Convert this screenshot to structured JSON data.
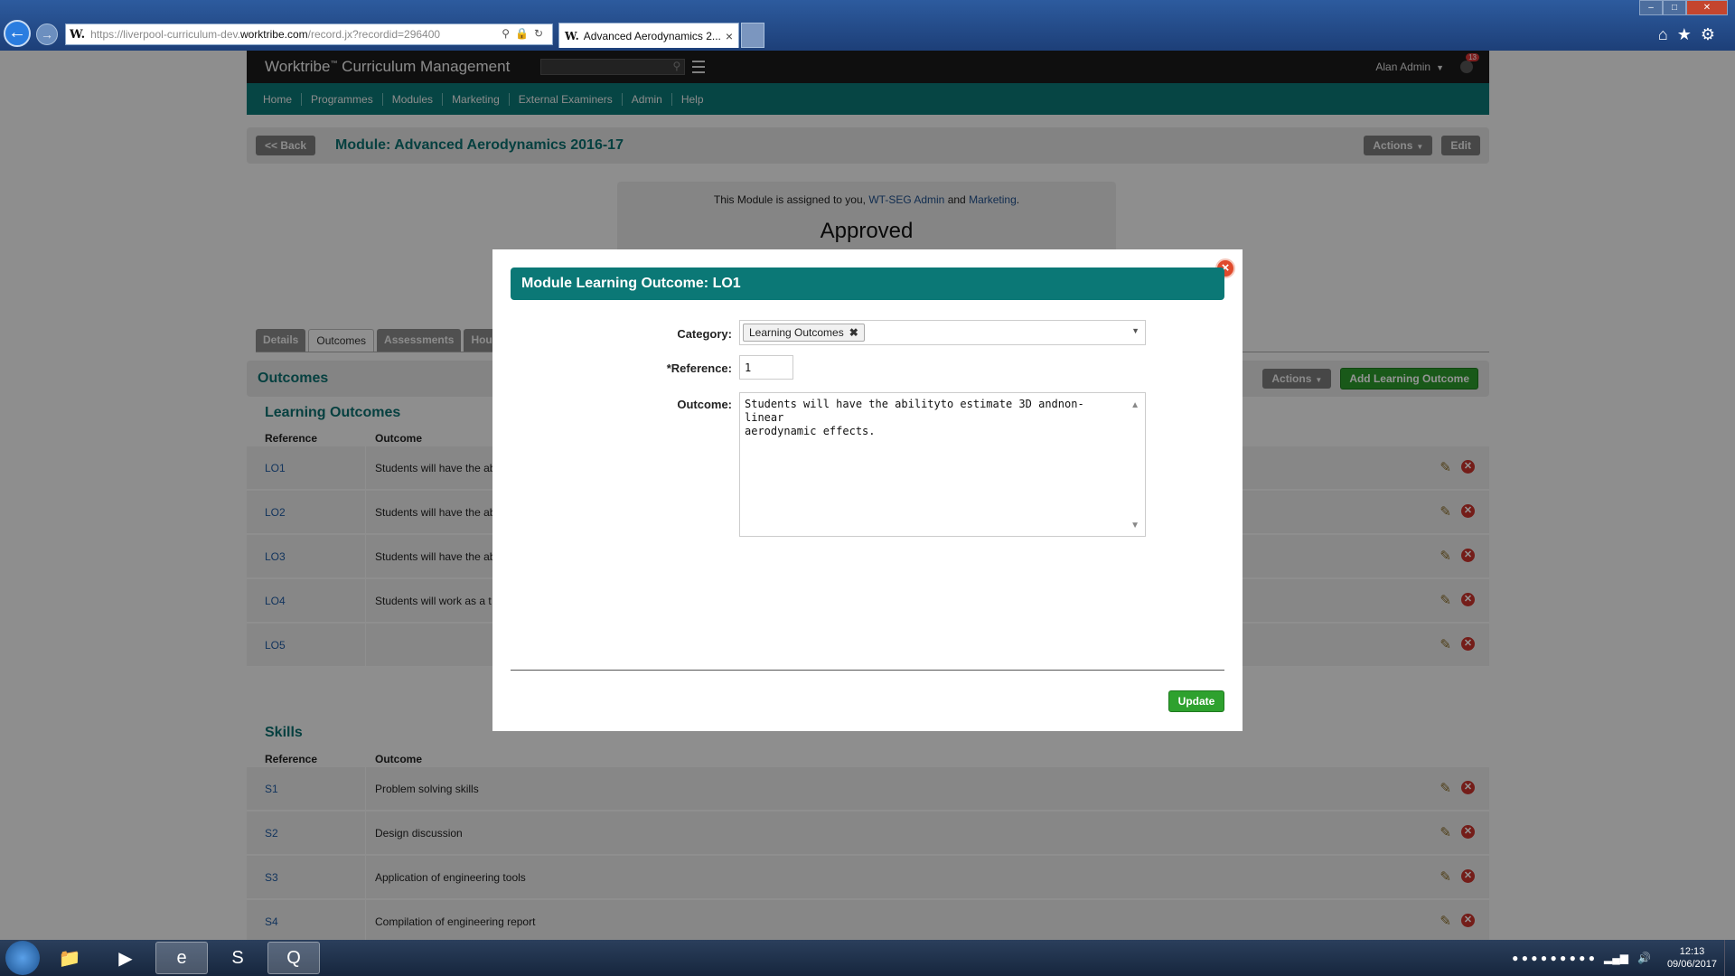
{
  "browser": {
    "favicon_letter": "W.",
    "url_prefix": "https://liverpool-curriculum-dev.",
    "url_domain": "worktribe.com",
    "url_path": "/record.jx?recordid=296400",
    "tab_title": "Advanced Aerodynamics 2...",
    "tab_close": "×"
  },
  "app": {
    "title": "Worktribe",
    "title_mark": "™",
    "title_rest": " Curriculum Management",
    "user": "Alan Admin",
    "notifications": "13"
  },
  "nav": [
    "Home",
    "Programmes",
    "Modules",
    "Marketing",
    "External Examiners",
    "Admin",
    "Help"
  ],
  "record": {
    "back_label": "<< Back",
    "title": "Module: Advanced Aerodynamics 2016-17",
    "actions_label": "Actions",
    "edit_label": "Edit"
  },
  "assignment": {
    "prefix": "This Module is assigned to you,",
    "link1": "WT-SEG Admin",
    "mid": "and",
    "link2": "Marketing",
    "suffix": ".",
    "status": "Approved"
  },
  "tabs": [
    "Details",
    "Outcomes",
    "Assessments",
    "Hour"
  ],
  "outcomes": {
    "title": "Outcomes",
    "actions_label": "Actions",
    "add_label": "Add Learning Outcome",
    "learning_title": "Learning Outcomes",
    "col_reference": "Reference",
    "col_outcome": "Outcome",
    "learning_rows": [
      {
        "ref": "LO1",
        "text": "Students will have the ab"
      },
      {
        "ref": "LO2",
        "text": "Students will have the ab"
      },
      {
        "ref": "LO3",
        "text": "Students will have the ab"
      },
      {
        "ref": "LO4",
        "text": "Students will work as a t"
      },
      {
        "ref": "LO5",
        "text": ""
      }
    ],
    "skills_title": "Skills",
    "skills_rows": [
      {
        "ref": "S1",
        "text": "Problem solving skills"
      },
      {
        "ref": "S2",
        "text": "Design discussion"
      },
      {
        "ref": "S3",
        "text": "Application of engineering tools"
      },
      {
        "ref": "S4",
        "text": "Compilation of engineering report"
      }
    ]
  },
  "modal": {
    "title": "Module Learning Outcome: LO1",
    "category_label": "Category:",
    "category_value": "Learning Outcomes",
    "reference_label": "*Reference:",
    "reference_value": "1",
    "outcome_label": "Outcome:",
    "outcome_value": "Students will have the abilityto estimate 3D andnon-linear\naerodynamic effects.",
    "update_label": "Update"
  },
  "taskbar": {
    "time": "12:13",
    "date": "09/06/2017"
  },
  "icons": [
    "back-arrow-icon",
    "forward-arrow-icon",
    "search-icon",
    "lock-icon",
    "refresh-icon",
    "home-icon",
    "star-icon",
    "gear-icon",
    "pencil-icon",
    "delete-icon",
    "close-icon",
    "chevron-down-icon"
  ],
  "colors": {
    "teal": "#0b7876",
    "green": "#2b9a2b",
    "danger": "#c9322b",
    "header_dark": "#1a1a1a"
  }
}
